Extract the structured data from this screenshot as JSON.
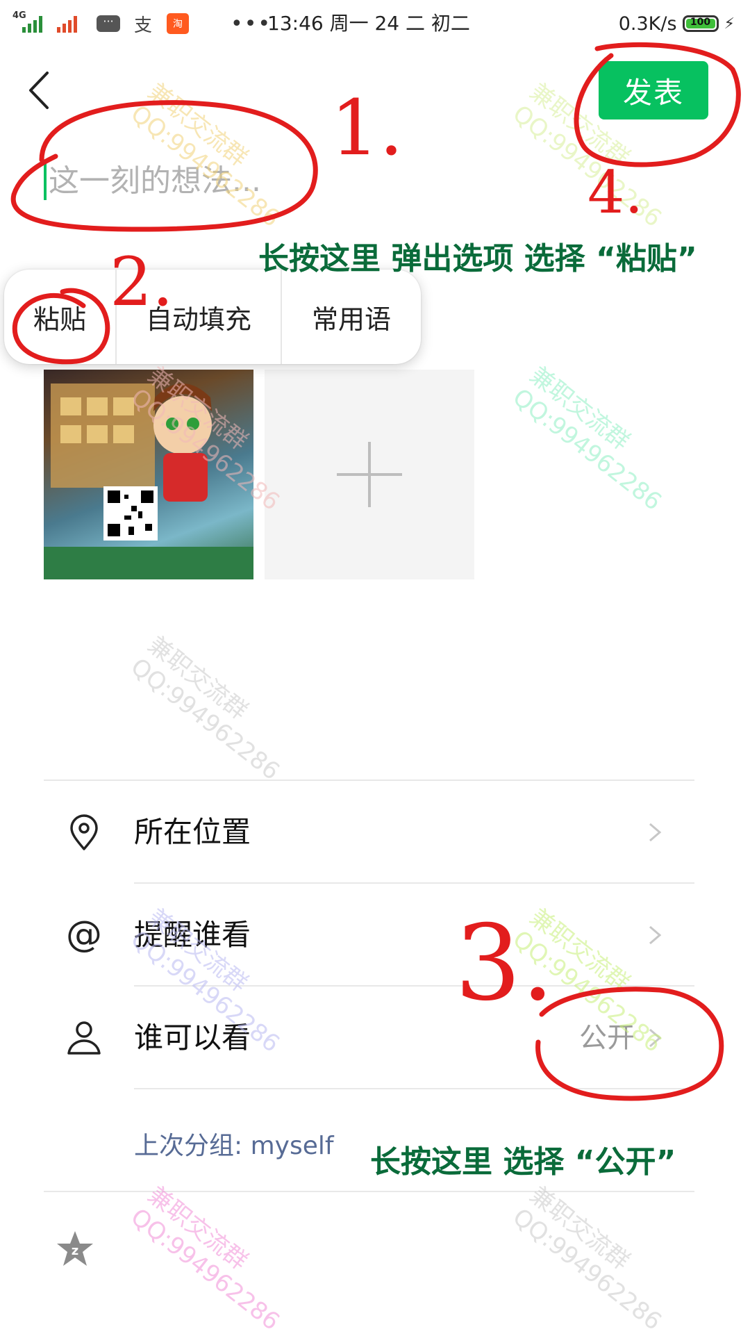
{
  "status_bar": {
    "network_label": "4G",
    "chat_icon": "message-icon",
    "alipay_glyph": "支",
    "taobao_label": "淘",
    "overflow": "•••",
    "time_text": "13:46 周一 24 二 初二",
    "speed": "0.3K/s",
    "battery": "100",
    "bolt": "⚡"
  },
  "header": {
    "back_icon": "back-chevron-icon",
    "post_label": "发表"
  },
  "composer": {
    "placeholder": "这一刻的想法..."
  },
  "context_menu": {
    "items": [
      "粘贴",
      "自动填充",
      "常用语"
    ]
  },
  "media": {
    "add_icon": "plus-icon"
  },
  "options": {
    "location_label": "所在位置",
    "mention_label": "提醒谁看",
    "visibility_label": "谁可以看",
    "visibility_value": "公开",
    "last_group": "上次分组: myself"
  },
  "footer": {
    "qzone_icon": "qzone-star-icon"
  },
  "annotations": {
    "tip_paste": "长按这里 弹出选项 选择 “粘贴”",
    "tip_public": "长按这里 选择 “公开”",
    "mark1": "1.",
    "mark2": "2.",
    "mark3": "3.",
    "mark4": "4."
  },
  "watermark": {
    "line1": "兼职交流群",
    "line2": "QQ:994962286"
  },
  "colors": {
    "accent": "#07c160",
    "annotation_red": "#e21d1d",
    "annotation_green": "#0a6b3a",
    "link_blue": "#576b95"
  }
}
